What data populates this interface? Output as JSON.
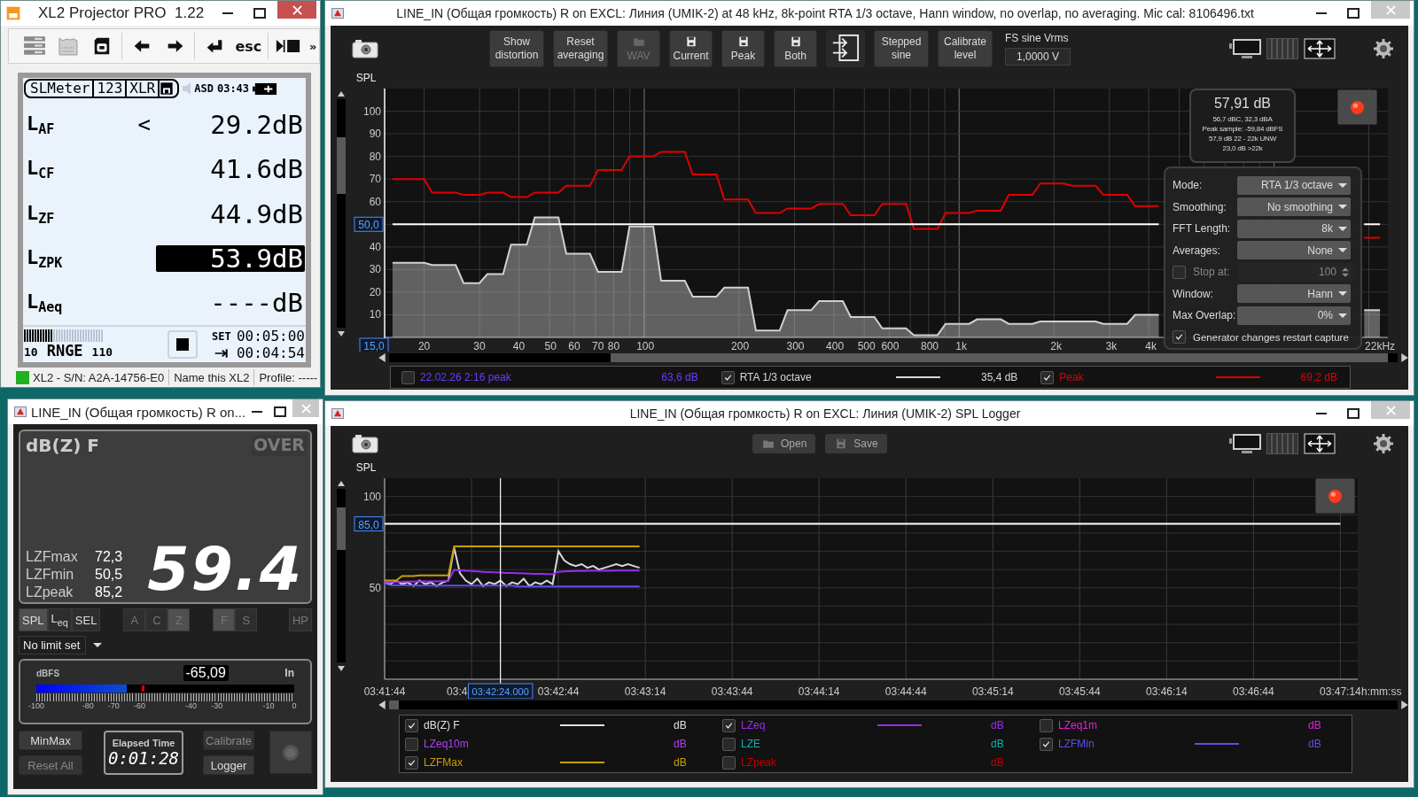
{
  "xl2_window": {
    "title": "XL2 Projector PRO  1.22",
    "active": true,
    "toolbar": {
      "esc": "esc",
      "more": "»"
    },
    "lcd": {
      "tabs": [
        "SLMeter",
        "123",
        "XLR"
      ],
      "mode": "ASD",
      "clock": "03:43",
      "rows": [
        {
          "label": "L$_{AF}$",
          "prefix": "<",
          "value": "29.2",
          "unit": "dB",
          "selected": false
        },
        {
          "label": "L$_{CF}$",
          "value": "41.6",
          "unit": "dB",
          "selected": false
        },
        {
          "label": "L$_{ZF}$",
          "value": "44.9",
          "unit": "dB",
          "selected": false
        },
        {
          "label": "L$_{ZPK}$",
          "value": "53.9",
          "unit": "dB",
          "selected": true
        },
        {
          "label": "L$_{Aeq}$",
          "value": "----",
          "unit": "dB",
          "selected": false
        }
      ],
      "level": 0.37,
      "range_low": "10",
      "range_label": "RNGE",
      "range_high": "110",
      "set_label": "SET",
      "set_time": "00:05:00",
      "remaining_time": "00:04:54"
    },
    "status_bar": {
      "connected": true,
      "serial": "XL2 - S/N: A2A-14756-E0",
      "name": "Name this XL2",
      "profile": "Profile: -----"
    }
  },
  "rta_window": {
    "title": "LINE_IN (Общая громкость) R on EXCL: Линия (UMIK-2) at 48 kHz, 8k-point RTA 1/3 octave, Hann window, no overlap, no averaging. Mic cal: 8106496.txt",
    "active": false,
    "buttons": [
      {
        "kind": "text",
        "label": "Show distortion",
        "disabled": false
      },
      {
        "kind": "text",
        "label": "Reset averaging",
        "disabled": false
      },
      {
        "kind": "folder",
        "label": "WAV",
        "disabled": true
      },
      {
        "kind": "save",
        "label": "Current",
        "disabled": false
      },
      {
        "kind": "save",
        "label": "Peak",
        "disabled": false
      },
      {
        "kind": "save",
        "label": "Both",
        "disabled": false
      },
      {
        "kind": "generator",
        "disabled": false
      },
      {
        "kind": "text",
        "label": "Stepped sine",
        "disabled": false
      },
      {
        "kind": "text",
        "label": "Calibrate level",
        "disabled": false
      }
    ],
    "fs_field": {
      "label": "FS sine Vrms",
      "value": "1,0000 V"
    },
    "axis_label": "SPL",
    "chart_data": {
      "type": "line",
      "grid": true,
      "ylim": [
        0,
        110
      ],
      "categories": [
        null,
        null,
        null,
        null,
        "20",
        null,
        null,
        null,
        null,
        null,
        null,
        "30",
        null,
        null,
        null,
        null,
        "40",
        null,
        null,
        null,
        "50",
        null,
        null,
        "60",
        null,
        null,
        "70",
        null,
        "80",
        null,
        null,
        null,
        "100",
        null,
        null,
        null,
        null,
        null,
        null,
        null,
        null,
        null,
        null,
        null,
        "200",
        null,
        null,
        null,
        null,
        null,
        null,
        "300",
        null,
        null,
        null,
        null,
        "400",
        null,
        null,
        null,
        "500",
        null,
        null,
        "600",
        null,
        null,
        null,
        null,
        "800",
        null,
        null,
        null,
        "1k",
        null,
        null,
        null,
        null,
        null,
        null,
        null,
        null,
        null,
        null,
        null,
        "2k",
        null,
        null,
        null,
        null,
        null,
        null,
        "3k",
        null,
        null,
        null,
        null,
        "4k",
        null,
        null,
        null,
        null,
        null,
        null,
        null,
        null,
        null,
        null,
        null,
        null,
        null,
        null,
        null,
        null,
        null,
        null,
        null,
        null,
        null,
        null,
        null,
        null,
        null,
        null,
        null,
        null,
        "22kHz"
      ],
      "series": [
        {
          "color": "#d0d0d0",
          "values": [
            33,
            33,
            33,
            33,
            33,
            32,
            32,
            32,
            32,
            24,
            24,
            24,
            28,
            28,
            28,
            41,
            41,
            41,
            53,
            53,
            53,
            53,
            37,
            37,
            37,
            37,
            29,
            29,
            29,
            29,
            49,
            49,
            49,
            49,
            25,
            25,
            25,
            25,
            18,
            18,
            18,
            18,
            22,
            22,
            22,
            22,
            3,
            3,
            3,
            3,
            12,
            12,
            12,
            12,
            16,
            16,
            16,
            16,
            9,
            9,
            9,
            9,
            4,
            4,
            4,
            4,
            1,
            1,
            1,
            1,
            6,
            6,
            6,
            6,
            8,
            8,
            8,
            8,
            6,
            6,
            6,
            6,
            7,
            7,
            7,
            7,
            7,
            7,
            7,
            7,
            6,
            6,
            6,
            6,
            10,
            10,
            10,
            10,
            null,
            null,
            null,
            null,
            null,
            null,
            null,
            null,
            null,
            null,
            null,
            null,
            null,
            null,
            null,
            null,
            null,
            null,
            null,
            null,
            null,
            null,
            null,
            null,
            null,
            12,
            12,
            12
          ]
        },
        {
          "color": "#e00000",
          "values": [
            70,
            70,
            70,
            70,
            70,
            64,
            64,
            64,
            64,
            63,
            63,
            63,
            64,
            64,
            64,
            62,
            62,
            62,
            64,
            64,
            64,
            64,
            67,
            67,
            67,
            67,
            74,
            74,
            74,
            74,
            80,
            80,
            80,
            80,
            82,
            82,
            82,
            82,
            72,
            72,
            72,
            72,
            61,
            61,
            61,
            61,
            55,
            55,
            55,
            55,
            57,
            57,
            57,
            57,
            59,
            59,
            59,
            59,
            54,
            54,
            54,
            54,
            59,
            59,
            59,
            59,
            48,
            48,
            48,
            48,
            55,
            55,
            55,
            55,
            56,
            56,
            56,
            56,
            63,
            63,
            63,
            63,
            68,
            68,
            68,
            68,
            67,
            67,
            67,
            67,
            63,
            63,
            63,
            63,
            58,
            58,
            58,
            58,
            null,
            null,
            null,
            null,
            null,
            null,
            null,
            null,
            null,
            null,
            null,
            null,
            null,
            null,
            null,
            null,
            null,
            null,
            null,
            null,
            null,
            null,
            null,
            null,
            null,
            44,
            44,
            44
          ]
        },
        {
          "color": "#ffffff",
          "values": [
            50,
            50,
            50,
            50,
            50,
            50,
            50,
            50,
            50,
            50,
            50,
            50,
            50,
            50,
            50,
            50,
            50,
            50,
            50,
            50,
            50,
            50,
            50,
            50,
            50,
            50,
            50,
            50,
            50,
            50,
            50,
            50,
            50,
            50,
            50,
            50,
            50,
            50,
            50,
            50,
            50,
            50,
            50,
            50,
            50,
            50,
            50,
            50,
            50,
            50,
            50,
            50,
            50,
            50,
            50,
            50,
            50,
            50,
            50,
            50,
            50,
            50,
            50,
            50,
            50,
            50,
            50,
            50,
            50,
            50,
            50,
            50,
            50,
            50,
            50,
            50,
            50,
            50,
            50,
            50,
            50,
            50,
            50,
            50,
            50,
            50,
            50,
            50,
            50,
            50,
            50,
            50,
            50,
            50,
            50,
            50,
            50,
            50,
            null,
            null,
            null,
            null,
            null,
            null,
            null,
            null,
            null,
            null,
            null,
            null,
            null,
            null,
            null,
            null,
            null,
            null,
            null,
            null,
            null,
            null,
            null,
            null,
            null,
            50,
            50,
            50
          ]
        }
      ],
      "yticks": [
        10,
        20,
        30,
        40,
        60,
        70,
        80,
        90,
        100
      ]
    },
    "cursors": [
      {
        "kind": "horizontal",
        "label": "50,0"
      },
      {
        "kind": "vertical",
        "label": "15,0",
        "level": 0
      }
    ],
    "readout": {
      "value": "57,91 dB",
      "lines": [
        "56,7 dBC, 32,3 dBA",
        "Peak sample: -59,84 dBFS",
        "57,9 dB 22 - 22k UNW",
        "23,0 dB >22k"
      ]
    },
    "record": {
      "recording": true
    },
    "settings": [
      {
        "kind": "select",
        "label": "Mode:",
        "value": "RTA 1/3 octave"
      },
      {
        "kind": "select",
        "label": "Smoothing:",
        "value": "No smoothing"
      },
      {
        "kind": "select",
        "label": "FFT Length:",
        "value": "8k"
      },
      {
        "kind": "select",
        "label": "Averages:",
        "value": "None"
      },
      {
        "kind": "spin",
        "label": "Stop at:",
        "value": "100",
        "checked": false
      },
      {
        "kind": "select",
        "label": "Window:",
        "value": "Hann"
      },
      {
        "kind": "select",
        "label": "Max Overlap:",
        "value": "0%"
      },
      {
        "kind": "check",
        "label": "Generator changes restart capture",
        "checked": true
      }
    ],
    "legend": [
      {
        "label": "22.02.26 2:16 peak",
        "value": "63,6 dB",
        "color": "#6b3cff",
        "checked": false
      },
      {
        "label": "RTA 1/3 octave",
        "value": "35,4 dB",
        "color": "#d8d8d8",
        "checked": true
      },
      {
        "label": "Peak",
        "value": "69,2 dB",
        "color": "#e00000",
        "checked": true
      }
    ]
  },
  "spl_window": {
    "title": "LINE_IN (Общая громкость) R on...",
    "active": false,
    "mode": "dB(Z) F",
    "over": {
      "label": "OVER",
      "on": false
    },
    "stats": [
      {
        "label": "LZFmax",
        "value": "72,3"
      },
      {
        "label": "LZFmin",
        "value": "50,5"
      },
      {
        "label": "LZpeak",
        "value": "85,2"
      }
    ],
    "reading": "59.4",
    "button_groups": [
      {
        "disabled": false,
        "buttons": [
          {
            "label": "SPL",
            "selected": true
          },
          {
            "label": "L$_{eq}$",
            "selected": false
          },
          {
            "label": "SEL",
            "selected": false
          }
        ]
      },
      {
        "disabled": true,
        "buttons": [
          {
            "label": "A",
            "selected": false
          },
          {
            "label": "C",
            "selected": false
          },
          {
            "label": "Z",
            "selected": true
          }
        ]
      },
      {
        "disabled": true,
        "buttons": [
          {
            "label": "F",
            "selected": true
          },
          {
            "label": "S",
            "selected": false
          }
        ]
      },
      {
        "disabled": true,
        "buttons": [
          {
            "label": "HP",
            "selected": false
          }
        ]
      }
    ],
    "limit": "No limit set",
    "meter": {
      "label": "dBFS",
      "value": "-65,09",
      "channel": "In",
      "level": 0.35,
      "peak": {
        "level": 0.41
      },
      "scale": [
        "-100",
        "-80",
        "-70",
        "-60",
        "-40",
        "-30",
        "-10",
        "0"
      ]
    },
    "actions": [
      {
        "label": "MinMax",
        "disabled": false
      },
      {
        "label": "Reset All",
        "disabled": true
      }
    ],
    "elapsed": {
      "label": "Elapsed Time",
      "value": "0:01:28"
    },
    "actions_right": [
      {
        "label": "Calibrate",
        "disabled": true
      },
      {
        "label": "Logger",
        "disabled": false
      }
    ],
    "record": {
      "recording": false
    }
  },
  "logger_window": {
    "title": "LINE_IN (Общая громкость) R on EXCL: Линия (UMIK-2) SPL Logger",
    "active": false,
    "buttons": [
      {
        "kind": "folder",
        "label": "Open"
      },
      {
        "kind": "save",
        "label": "Save"
      }
    ],
    "axis_label": "SPL",
    "chart_data": {
      "type": "line",
      "grid": true,
      "xlabel": "h:mm:ss",
      "ylim": [
        0,
        110
      ],
      "categories": [
        "03:41:44",
        null,
        null,
        null,
        null,
        null,
        null,
        null,
        null,
        null,
        null,
        null,
        null,
        null,
        null,
        null,
        null,
        null,
        null,
        null,
        null,
        null,
        null,
        null,
        null,
        null,
        null,
        null,
        null,
        null,
        "03:42:44",
        null,
        null,
        null,
        null,
        null,
        null,
        null,
        null,
        null,
        null,
        null,
        null,
        null,
        null,
        "03:43:14",
        null,
        null,
        null,
        null,
        null,
        null,
        null,
        null,
        null,
        null,
        null,
        null,
        null,
        null,
        "03:43:44",
        null,
        null,
        null,
        null,
        null,
        null,
        null,
        null,
        null,
        null,
        null,
        null,
        null,
        null,
        "03:44:14",
        null,
        null,
        null,
        null,
        null,
        null,
        null,
        null,
        null,
        null,
        null,
        null,
        null,
        null,
        "03:44:44",
        null,
        null,
        null,
        null,
        null,
        null,
        null,
        null,
        null,
        null,
        null,
        null,
        null,
        null,
        "03:45:14",
        null,
        null,
        null,
        null,
        null,
        null,
        null,
        null,
        null,
        null,
        null,
        null,
        null,
        null,
        "03:45:44",
        null,
        null,
        null,
        null,
        null,
        null,
        null,
        null,
        null,
        null,
        null,
        null,
        null,
        null,
        "03:46:14",
        null,
        null,
        null,
        null,
        null,
        null,
        null,
        null,
        null,
        null,
        null,
        null,
        null,
        null,
        "03:46:44",
        null,
        null,
        null,
        null,
        null,
        null,
        null,
        null,
        null,
        null,
        null,
        null,
        null,
        null,
        "03:47:14"
      ],
      "series": [
        {
          "color": "#d8d8d8",
          "values": [
            53,
            52,
            54,
            52,
            53,
            51,
            54,
            52,
            53,
            51,
            53,
            54,
            72,
            58,
            54,
            52,
            55,
            51,
            53,
            52,
            54,
            51,
            53,
            52,
            55,
            51,
            53,
            52,
            54,
            52,
            70,
            65,
            63,
            62,
            63,
            61,
            62,
            60,
            61,
            62,
            63,
            62,
            63,
            62,
            61,
            null,
            null,
            null,
            null,
            null,
            null,
            null,
            null,
            null,
            null,
            null,
            null,
            null,
            null,
            null,
            null,
            null,
            null,
            null,
            null,
            null,
            null,
            null,
            null,
            null,
            null,
            null,
            null,
            null,
            null,
            null,
            null,
            null,
            null,
            null,
            null,
            null,
            null,
            null,
            null,
            null,
            null,
            null,
            null,
            null,
            null,
            null,
            null,
            null,
            null,
            null,
            null,
            null,
            null,
            null,
            null,
            null,
            null,
            null,
            null,
            null,
            null,
            null,
            null,
            null,
            null,
            null,
            null,
            null,
            null,
            null,
            null,
            null,
            null,
            null,
            null,
            null,
            null,
            null,
            null,
            null,
            null,
            null,
            null,
            null,
            null,
            null,
            null,
            null,
            null,
            null,
            null,
            null,
            null,
            null,
            null,
            null,
            null,
            null,
            null,
            null,
            null,
            null,
            null,
            null,
            null,
            null,
            null,
            null,
            null,
            null,
            null,
            null,
            null,
            null,
            null,
            null,
            null,
            null,
            null,
            null
          ]
        },
        {
          "color": "#9a2cf0",
          "values": [
            53,
            53,
            53.2,
            53.3,
            53.4,
            53.4,
            53.5,
            53.5,
            53.6,
            53.6,
            53.7,
            53.8,
            59.8,
            59.6,
            59.4,
            59.2,
            59,
            58.8,
            58.7,
            58.5,
            58.4,
            58.2,
            58.1,
            58,
            57.9,
            57.8,
            57.7,
            57.6,
            57.5,
            57.4,
            58.8,
            59,
            59.1,
            59.2,
            59.2,
            59.3,
            59.3,
            59.4,
            59.4,
            59.4,
            59.5,
            59.5,
            59.5,
            59.5,
            59.5,
            null,
            null,
            null,
            null,
            null,
            null,
            null,
            null,
            null,
            null,
            null,
            null,
            null,
            null,
            null,
            null,
            null,
            null,
            null,
            null,
            null,
            null,
            null,
            null,
            null,
            null,
            null,
            null,
            null,
            null,
            null,
            null,
            null,
            null,
            null,
            null,
            null,
            null,
            null,
            null,
            null,
            null,
            null,
            null,
            null,
            null,
            null,
            null,
            null,
            null,
            null,
            null,
            null,
            null,
            null,
            null,
            null,
            null,
            null,
            null,
            null,
            null,
            null,
            null,
            null,
            null,
            null,
            null,
            null,
            null,
            null,
            null,
            null,
            null,
            null,
            null,
            null,
            null,
            null,
            null,
            null,
            null,
            null,
            null,
            null,
            null,
            null,
            null,
            null,
            null,
            null,
            null,
            null,
            null,
            null,
            null,
            null,
            null,
            null,
            null,
            null,
            null,
            null,
            null,
            null,
            null,
            null,
            null,
            null,
            null,
            null,
            null,
            null,
            null,
            null,
            null,
            null,
            null,
            null,
            null,
            null
          ]
        },
        {
          "color": "#5a4ff0",
          "values": [
            52.3,
            51.5,
            51.4,
            51.4,
            51.4,
            51.4,
            51.2,
            51.2,
            51.2,
            51.2,
            51.2,
            51.2,
            51.2,
            51.2,
            51.2,
            51.2,
            51.2,
            51.2,
            51.2,
            51.2,
            51.2,
            51.2,
            51.2,
            50.8,
            50.8,
            50.8,
            50.8,
            50.8,
            50.8,
            50.8,
            50.8,
            50.8,
            50.8,
            50.8,
            50.8,
            50.8,
            50.8,
            50.8,
            50.8,
            50.8,
            50.8,
            50.8,
            50.8,
            50.8,
            50.8,
            null,
            null,
            null,
            null,
            null,
            null,
            null,
            null,
            null,
            null,
            null,
            null,
            null,
            null,
            null,
            null,
            null,
            null,
            null,
            null,
            null,
            null,
            null,
            null,
            null,
            null,
            null,
            null,
            null,
            null,
            null,
            null,
            null,
            null,
            null,
            null,
            null,
            null,
            null,
            null,
            null,
            null,
            null,
            null,
            null,
            null,
            null,
            null,
            null,
            null,
            null,
            null,
            null,
            null,
            null,
            null,
            null,
            null,
            null,
            null,
            null,
            null,
            null,
            null,
            null,
            null,
            null,
            null,
            null,
            null,
            null,
            null,
            null,
            null,
            null,
            null,
            null,
            null,
            null,
            null,
            null,
            null,
            null,
            null,
            null,
            null,
            null,
            null,
            null,
            null,
            null,
            null,
            null,
            null,
            null,
            null,
            null,
            null,
            null,
            null,
            null,
            null,
            null,
            null,
            null,
            null,
            null,
            null,
            null,
            null,
            null,
            null,
            null,
            null,
            null,
            null,
            null,
            null,
            null,
            null,
            null
          ]
        },
        {
          "color": "#c8a000",
          "values": [
            54,
            54,
            54,
            56.5,
            56.5,
            56.5,
            56.8,
            56.8,
            56.8,
            56.8,
            56.8,
            56.8,
            72.7,
            72.7,
            72.7,
            72.7,
            72.7,
            72.7,
            72.7,
            72.7,
            72.7,
            72.7,
            72.7,
            72.7,
            72.7,
            72.7,
            72.7,
            72.7,
            72.7,
            72.7,
            72.7,
            72.7,
            72.7,
            72.7,
            72.7,
            72.7,
            72.7,
            72.7,
            72.7,
            72.7,
            72.7,
            72.7,
            72.7,
            72.7,
            72.7,
            null,
            null,
            null,
            null,
            null,
            null,
            null,
            null,
            null,
            null,
            null,
            null,
            null,
            null,
            null,
            null,
            null,
            null,
            null,
            null,
            null,
            null,
            null,
            null,
            null,
            null,
            null,
            null,
            null,
            null,
            null,
            null,
            null,
            null,
            null,
            null,
            null,
            null,
            null,
            null,
            null,
            null,
            null,
            null,
            null,
            null,
            null,
            null,
            null,
            null,
            null,
            null,
            null,
            null,
            null,
            null,
            null,
            null,
            null,
            null,
            null,
            null,
            null,
            null,
            null,
            null,
            null,
            null,
            null,
            null,
            null,
            null,
            null,
            null,
            null,
            null,
            null,
            null,
            null,
            null,
            null,
            null,
            null,
            null,
            null,
            null,
            null,
            null,
            null,
            null,
            null,
            null,
            null,
            null,
            null,
            null,
            null,
            null,
            null,
            null,
            null,
            null,
            null,
            null,
            null,
            null,
            null,
            null,
            null,
            null,
            null,
            null,
            null,
            null,
            null,
            null,
            null,
            null,
            null,
            null,
            null
          ]
        },
        {
          "color": "#ffffff",
          "values": [
            85,
            85,
            85,
            85,
            85,
            85,
            85,
            85,
            85,
            85,
            85,
            85,
            85,
            85,
            85,
            85,
            85,
            85,
            85,
            85,
            85,
            85,
            85,
            85,
            85,
            85,
            85,
            85,
            85,
            85,
            85,
            85,
            85,
            85,
            85,
            85,
            85,
            85,
            85,
            85,
            85,
            85,
            85,
            85,
            85,
            85,
            85,
            85,
            85,
            85,
            85,
            85,
            85,
            85,
            85,
            85,
            85,
            85,
            85,
            85,
            85,
            85,
            85,
            85,
            85,
            85,
            85,
            85,
            85,
            85,
            85,
            85,
            85,
            85,
            85,
            85,
            85,
            85,
            85,
            85,
            85,
            85,
            85,
            85,
            85,
            85,
            85,
            85,
            85,
            85,
            85,
            85,
            85,
            85,
            85,
            85,
            85,
            85,
            85,
            85,
            85,
            85,
            85,
            85,
            85,
            85,
            85,
            85,
            85,
            85,
            85,
            85,
            85,
            85,
            85,
            85,
            85,
            85,
            85,
            85,
            85,
            85,
            85,
            85,
            85,
            85,
            85,
            85,
            85,
            85,
            85,
            85,
            85,
            85,
            85,
            85,
            85,
            85,
            85,
            85,
            85,
            85,
            85,
            85,
            85,
            85,
            85,
            85,
            85,
            85,
            85,
            85,
            85,
            85,
            85,
            85,
            85,
            85,
            85,
            85,
            85,
            85,
            85,
            85,
            85,
            85
          ]
        }
      ],
      "yticks": [
        50,
        100
      ]
    },
    "cursors": [
      {
        "kind": "horizontal",
        "label": "85,0"
      },
      {
        "kind": "vertical",
        "label": "03:42:24.000",
        "level": 0.119
      }
    ],
    "covered_tick_label": "03:4",
    "record": {
      "recording": true
    },
    "legend": [
      {
        "label": "dB(Z) F",
        "unit": "dB",
        "color": "#e0e0e0",
        "checked": true
      },
      {
        "label": "LZeq",
        "unit": "dB",
        "color": "#9a2cf0",
        "checked": true
      },
      {
        "label": "LZeq1m",
        "unit": "dB",
        "color": "#e020e0",
        "checked": false
      },
      {
        "label": "LZeq10m",
        "unit": "dB",
        "color": "#b040f0",
        "checked": false
      },
      {
        "label": "LZE",
        "unit": "dB",
        "color": "#10b0b0",
        "checked": false
      },
      {
        "label": "LZFMin",
        "unit": "dB",
        "color": "#5a4ff0",
        "checked": true
      },
      {
        "label": "LZFMax",
        "unit": "dB",
        "color": "#c8a000",
        "checked": true
      },
      {
        "label": "LZpeak",
        "unit": "dB",
        "color": "#c00000",
        "checked": false
      }
    ]
  }
}
